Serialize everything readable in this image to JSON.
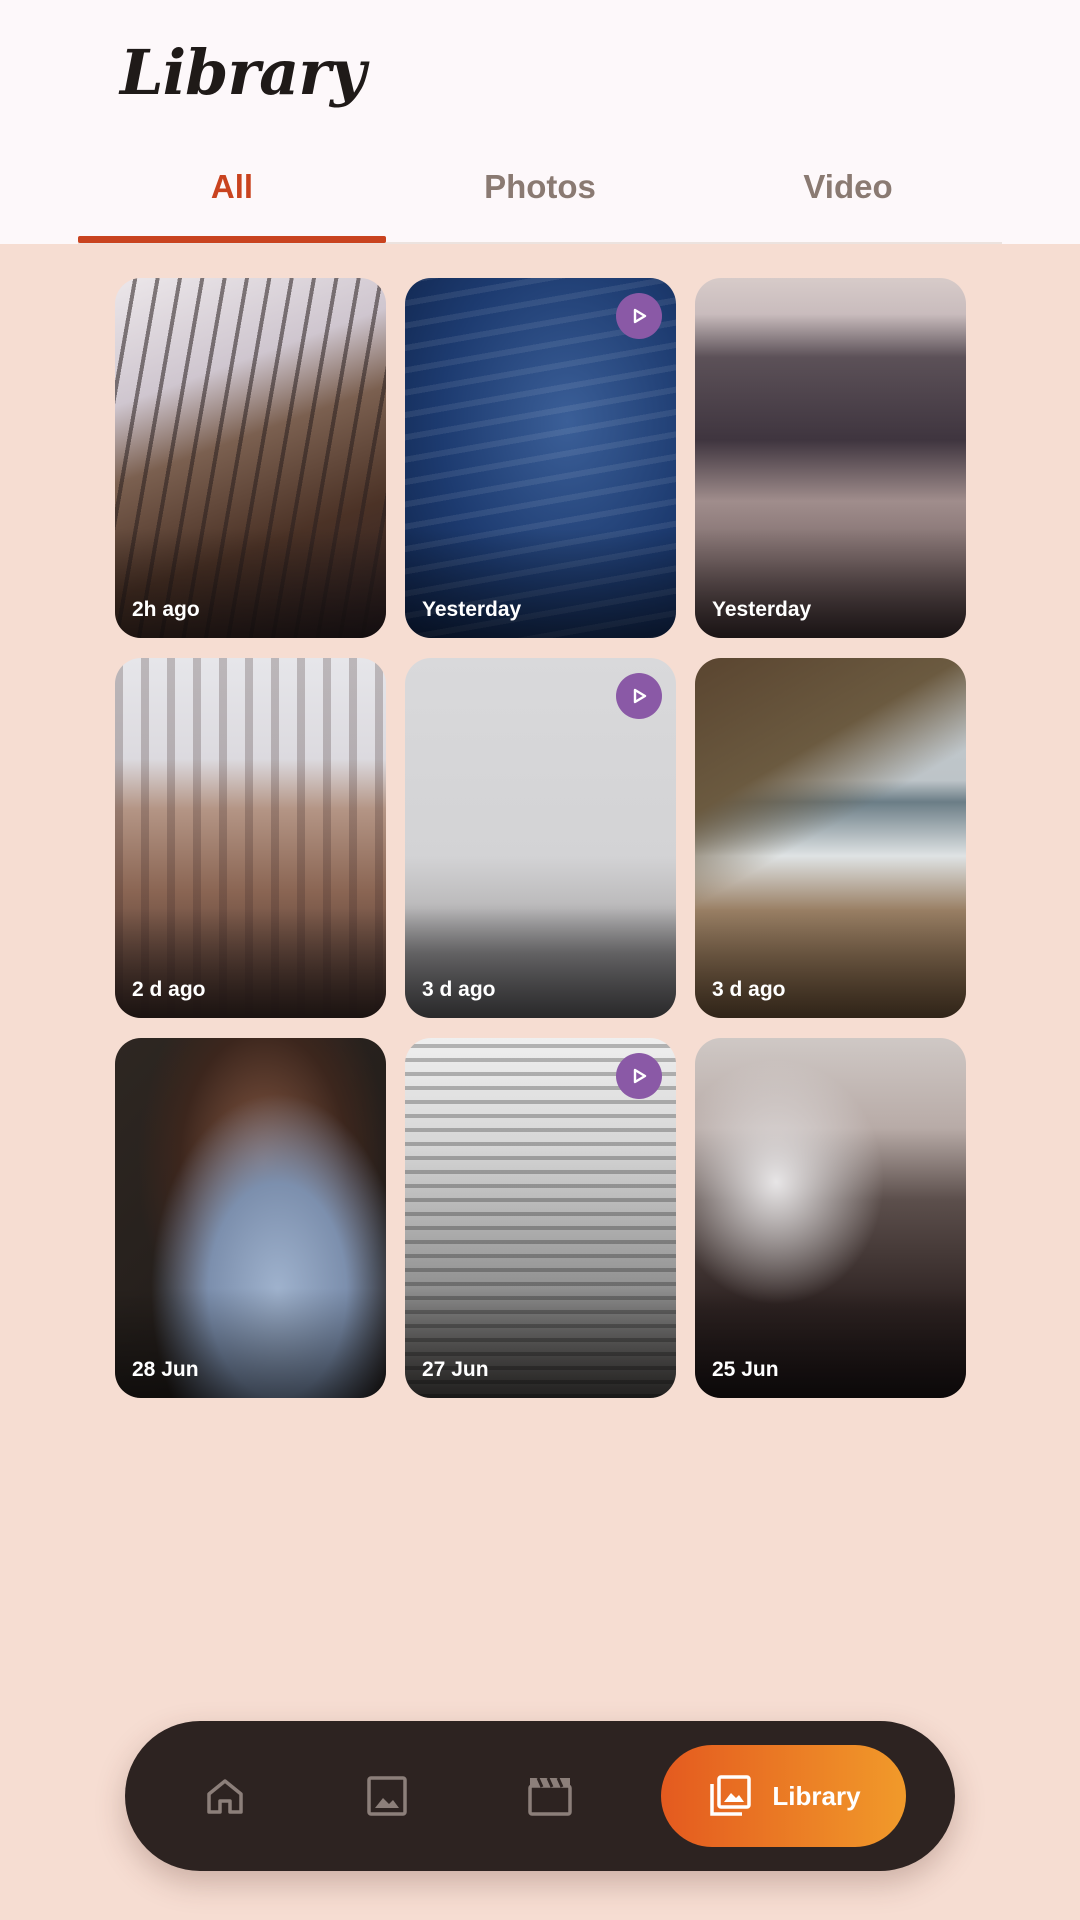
{
  "header": {
    "title": "Library"
  },
  "tabs": [
    {
      "label": "All",
      "active": true
    },
    {
      "label": "Photos",
      "active": false
    },
    {
      "label": "Video",
      "active": false
    }
  ],
  "media": [
    {
      "date": "2h ago",
      "type": "photo"
    },
    {
      "date": "Yesterday",
      "type": "video"
    },
    {
      "date": "Yesterday",
      "type": "photo"
    },
    {
      "date": "2 d ago",
      "type": "photo"
    },
    {
      "date": "3 d ago",
      "type": "video"
    },
    {
      "date": "3 d ago",
      "type": "photo"
    },
    {
      "date": "28 Jun",
      "type": "photo"
    },
    {
      "date": "27 Jun",
      "type": "video"
    },
    {
      "date": "25 Jun",
      "type": "photo"
    }
  ],
  "bottom_nav": {
    "items": [
      {
        "icon": "home-icon"
      },
      {
        "icon": "image-icon"
      },
      {
        "icon": "clapperboard-icon"
      }
    ],
    "active_label": "Library",
    "active_icon": "library-icon"
  },
  "colors": {
    "accent": "#c9431f",
    "background": "#f6ddd2",
    "play_badge": "#8a59a6",
    "nav_bar": "#2d2321",
    "nav_active_start": "#e45a1f",
    "nav_active_end": "#f19a2a"
  }
}
